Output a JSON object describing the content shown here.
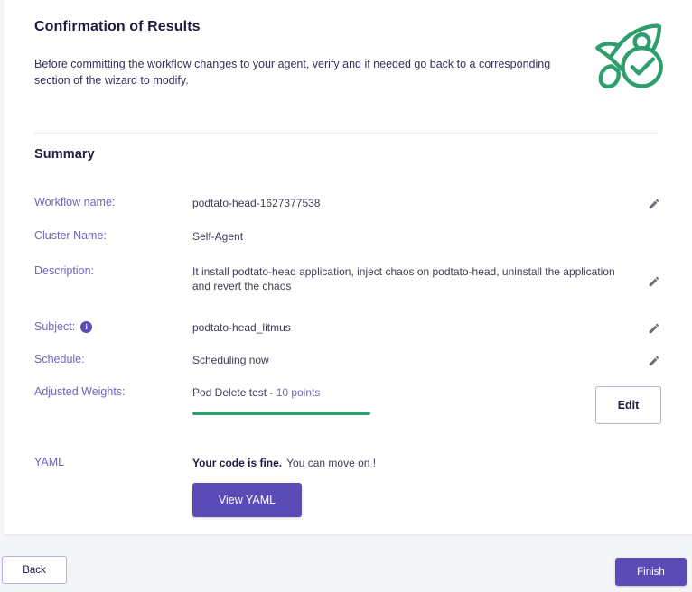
{
  "header": {
    "title": "Confirmation of Results",
    "description": "Before committing the workflow changes to your agent, verify and if needed go back to a corresponding section of the wizard to modify.",
    "icon": "rocket-check-icon",
    "icon_color": "#2f9e6e"
  },
  "summary": {
    "title": "Summary",
    "rows": {
      "workflow": {
        "label": "Workflow name:",
        "value": "podtato-head-1627377538",
        "edit_icon": "pencil-icon"
      },
      "cluster": {
        "label": "Cluster Name:",
        "value": "Self-Agent"
      },
      "description": {
        "label": "Description:",
        "value": "It install podtato-head application, inject chaos on podtato-head, uninstall the application  and revert the chaos",
        "edit_icon": "pencil-icon"
      },
      "subject": {
        "label": "Subject:",
        "info_icon": "info-icon",
        "info_glyph": "i",
        "value": "podtato-head_litmus",
        "edit_icon": "pencil-icon"
      },
      "schedule": {
        "label": "Schedule:",
        "value": "Scheduling now",
        "edit_icon": "pencil-icon"
      },
      "weights": {
        "label": "Adjusted Weights:",
        "test_name": "Pod Delete test - ",
        "points": "10 points",
        "progress_percent": 100,
        "progress_color": "#2f9e6e",
        "edit_label": "Edit"
      },
      "yaml": {
        "label": "YAML",
        "status_strong": "Your code is fine.",
        "status_rest": "You can move on !",
        "button_label": "View YAML"
      }
    }
  },
  "footer": {
    "back_label": "Back",
    "finish_label": "Finish",
    "accent_color": "#5b4bb7"
  }
}
